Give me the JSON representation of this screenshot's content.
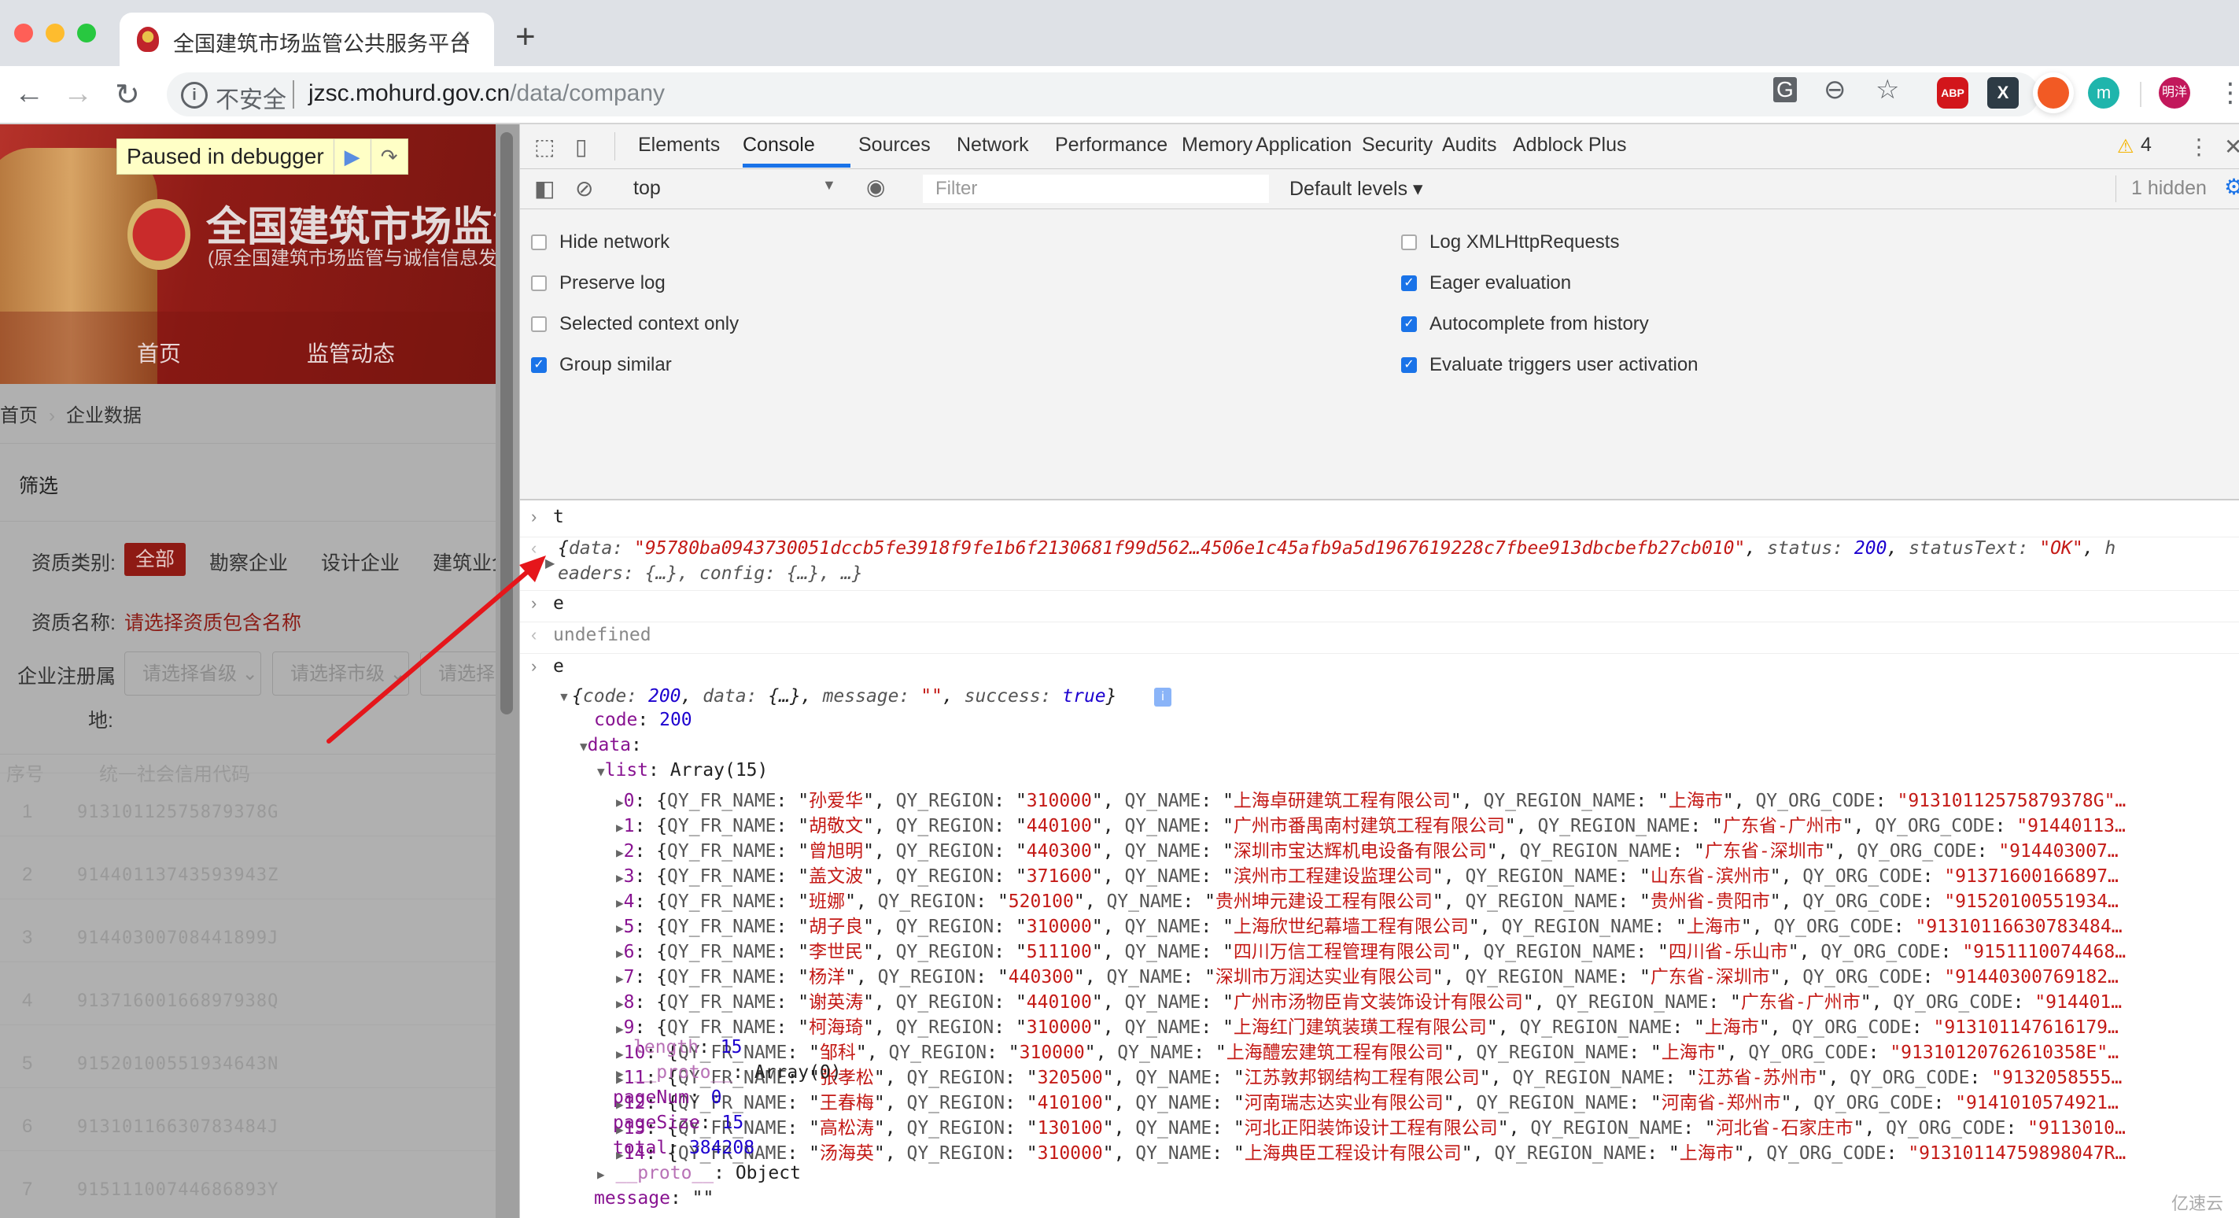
{
  "browser": {
    "tab_title": "全国建筑市场监管公共服务平台",
    "tab_close": "x",
    "new_tab": "+",
    "security_label": "不安全",
    "url_host": "jzsc.mohurd.gov.cn",
    "url_path": "/data/company",
    "profile_label": "明洋",
    "extensions": [
      "ABP",
      "X",
      "pencil",
      "m"
    ]
  },
  "page": {
    "paused_label": "Paused in debugger",
    "hero_title": "全国建筑市场监管",
    "hero_subtitle": "(原全国建筑市场监管与诚信信息发",
    "nav": [
      "首页",
      "监管动态"
    ],
    "breadcrumb": [
      "首页",
      "企业数据"
    ],
    "filter_title": "筛选",
    "qualification_type_label": "资质类别:",
    "qualification_types": [
      "全部",
      "勘察企业",
      "设计企业",
      "建筑业企"
    ],
    "qualification_name_label": "资质名称:",
    "qualification_name_placeholder": "请选择资质包含名称",
    "region_label_1": "企业注册属",
    "region_label_2": "地:",
    "region_selects": [
      "请选择省级",
      "请选择市级",
      "请选择"
    ],
    "table_headers": [
      "序号",
      "统一社会信用代码"
    ],
    "table_rows": [
      {
        "no": "1",
        "code": "91310112575879378G"
      },
      {
        "no": "2",
        "code": "91440113743593943Z"
      },
      {
        "no": "3",
        "code": "91440300708441899J"
      },
      {
        "no": "4",
        "code": "91371600166897938Q"
      },
      {
        "no": "5",
        "code": "91520100551934643N"
      },
      {
        "no": "6",
        "code": "91310116630783484J"
      },
      {
        "no": "7",
        "code": "91511100744686893Y"
      }
    ]
  },
  "devtools": {
    "tabs": [
      "Elements",
      "Console",
      "Sources",
      "Network",
      "Performance",
      "Memory",
      "Application",
      "Security",
      "Audits",
      "Adblock Plus"
    ],
    "active_tab": "Console",
    "warning_count": "4",
    "context": "top",
    "filter_placeholder": "Filter",
    "levels": "Default levels ▾",
    "hidden": "1 hidden",
    "settings_left": [
      {
        "label": "Hide network",
        "checked": false
      },
      {
        "label": "Preserve log",
        "checked": false
      },
      {
        "label": "Selected context only",
        "checked": false
      },
      {
        "label": "Group similar",
        "checked": true
      }
    ],
    "settings_right": [
      {
        "label": "Log XMLHttpRequests",
        "checked": false
      },
      {
        "label": "Eager evaluation",
        "checked": true
      },
      {
        "label": "Autocomplete from history",
        "checked": true
      },
      {
        "label": "Evaluate triggers user activation",
        "checked": true
      }
    ]
  },
  "console": {
    "input1": "t",
    "out1_data": "\"95780ba0943730051dccb5fe3918f9fe1b6f2130681f99d562…4506e1c45afb9a5d1967619228c7fbee913dbcbefb27cb010\"",
    "out1_status": "200",
    "out1_statusText": "\"OK\"",
    "out1_tail": "eaders: {…}, config: {…}, …}",
    "input2": "e",
    "out2": "undefined",
    "input3": "e",
    "summary_code": "200",
    "summary_message": "\"\"",
    "summary_success": "true",
    "code": "200",
    "list_label": "Array(15)",
    "list": [
      {
        "i": "0",
        "fr": "孙爱华",
        "region": "310000",
        "name": "上海卓研建筑工程有限公司",
        "region_name": "上海市",
        "org": "\"91310112575879378G\"…"
      },
      {
        "i": "1",
        "fr": "胡敬文",
        "region": "440100",
        "name": "广州市番禺南村建筑工程有限公司",
        "region_name": "广东省-广州市",
        "org": "\"91440113…"
      },
      {
        "i": "2",
        "fr": "曾旭明",
        "region": "440300",
        "name": "深圳市宝达辉机电设备有限公司",
        "region_name": "广东省-深圳市",
        "org": "\"914403007…"
      },
      {
        "i": "3",
        "fr": "盖文波",
        "region": "371600",
        "name": "滨州市工程建设监理公司",
        "region_name": "山东省-滨州市",
        "org": "\"91371600166897…"
      },
      {
        "i": "4",
        "fr": "班娜",
        "region": "520100",
        "name": "贵州坤元建设工程有限公司",
        "region_name": "贵州省-贵阳市",
        "org": "\"91520100551934…"
      },
      {
        "i": "5",
        "fr": "胡子良",
        "region": "310000",
        "name": "上海欣世纪幕墙工程有限公司",
        "region_name": "上海市",
        "org": "\"91310116630783484…"
      },
      {
        "i": "6",
        "fr": "李世民",
        "region": "511100",
        "name": "四川万信工程管理有限公司",
        "region_name": "四川省-乐山市",
        "org": "\"9151110074468…"
      },
      {
        "i": "7",
        "fr": "杨洋",
        "region": "440300",
        "name": "深圳市万润达实业有限公司",
        "region_name": "广东省-深圳市",
        "org": "\"91440300769182…"
      },
      {
        "i": "8",
        "fr": "谢英涛",
        "region": "440100",
        "name": "广州市汤物臣肯文装饰设计有限公司",
        "region_name": "广东省-广州市",
        "org": "\"914401…"
      },
      {
        "i": "9",
        "fr": "柯海琦",
        "region": "310000",
        "name": "上海红门建筑装璜工程有限公司",
        "region_name": "上海市",
        "org": "\"913101147616179…"
      },
      {
        "i": "10",
        "fr": "邹科",
        "region": "310000",
        "name": "上海醴宏建筑工程有限公司",
        "region_name": "上海市",
        "org": "\"91310120762610358E\"…"
      },
      {
        "i": "11",
        "fr": "张孝松",
        "region": "320500",
        "name": "江苏敦邦钢结构工程有限公司",
        "region_name": "江苏省-苏州市",
        "org": "\"9132058555…"
      },
      {
        "i": "12",
        "fr": "王春梅",
        "region": "410100",
        "name": "河南瑞志达实业有限公司",
        "region_name": "河南省-郑州市",
        "org": "\"9141010574921…"
      },
      {
        "i": "13",
        "fr": "高松涛",
        "region": "130100",
        "name": "河北正阳装饰设计工程有限公司",
        "region_name": "河北省-石家庄市",
        "org": "\"9113010…"
      },
      {
        "i": "14",
        "fr": "汤海英",
        "region": "310000",
        "name": "上海典臣工程设计有限公司",
        "region_name": "上海市",
        "org": "\"91310114759898047R…"
      }
    ],
    "length": "15",
    "list_proto": "Array(0)",
    "pageNum": "0",
    "pageSize": "15",
    "total": "384208",
    "data_proto": "Object",
    "message": "\"\""
  },
  "watermark": "亿速云",
  "colors": {
    "accent": "#1a73e8",
    "string": "#c41a16",
    "number": "#1c00cf",
    "key": "#881391",
    "brand_red": "#8e1a14",
    "annotation_arrow": "#e5161b"
  }
}
